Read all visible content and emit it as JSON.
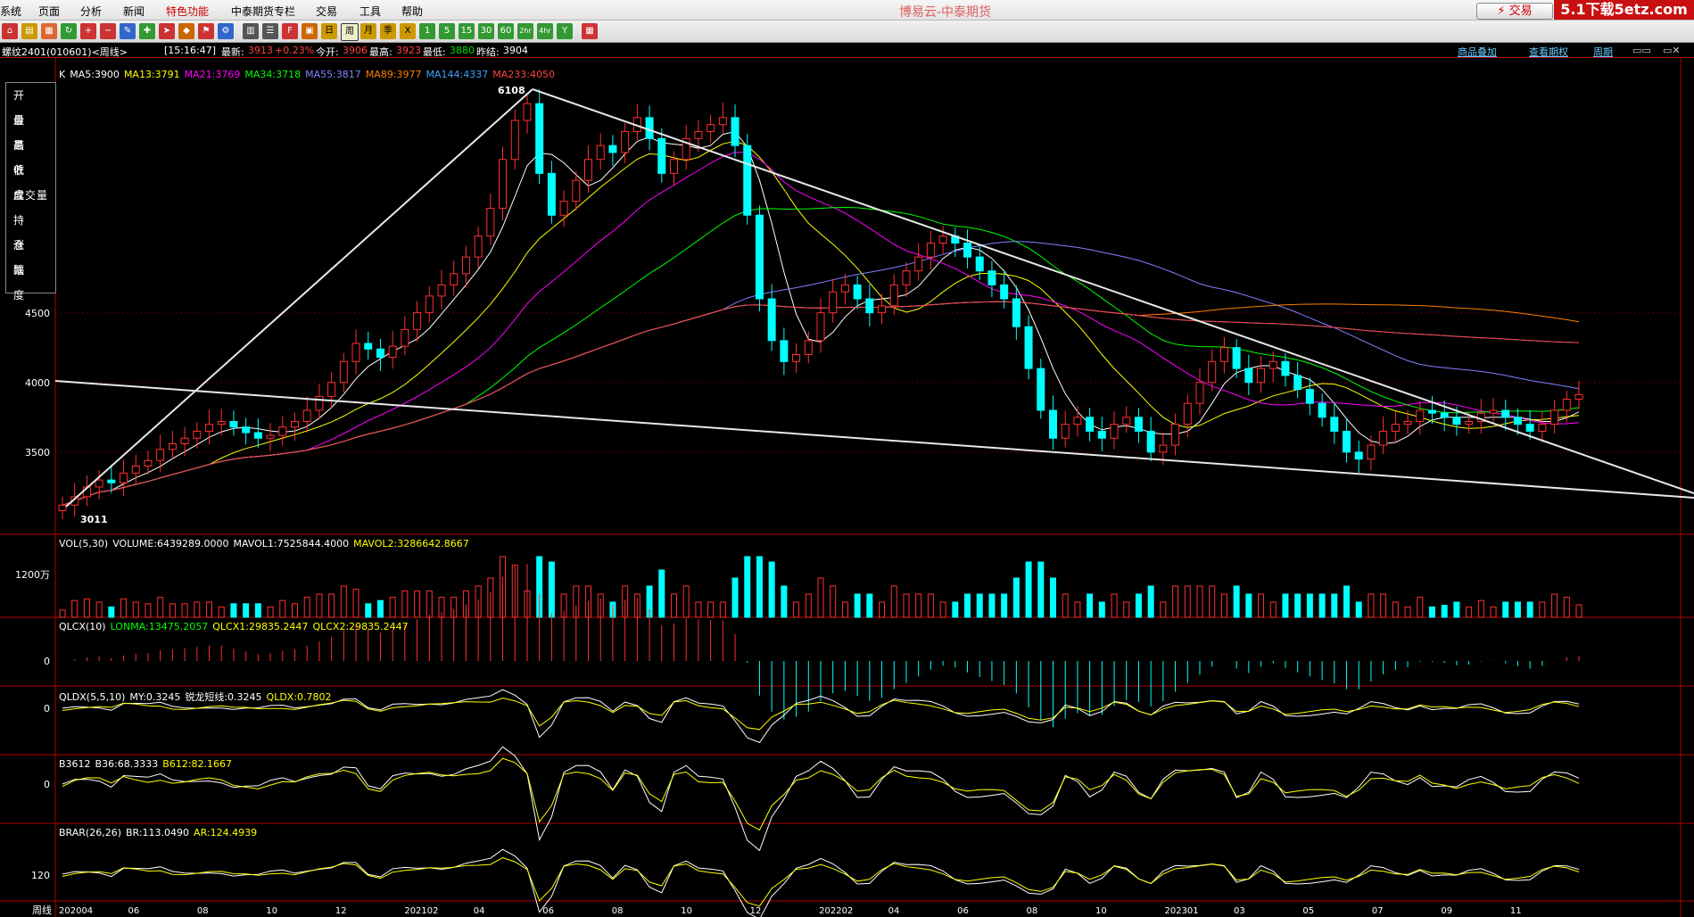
{
  "menu": [
    "系统",
    "页面",
    "分析",
    "新闻",
    "特色功能",
    "中泰期货专栏",
    "交易",
    "工具",
    "帮助"
  ],
  "app_title": "博易云-中泰期货",
  "trade_button": "交易",
  "watermark": "5.1下载5etz.com",
  "toolbar_buttons": [
    "home-icon",
    "folder-icon",
    "refresh-icon",
    "zoom-in-icon",
    "zoom-out-icon",
    "draw-icon",
    "crosshair-icon",
    "pin-icon",
    "table-icon",
    "text-icon",
    "ticket-icon",
    "calendar-icon",
    "week-icon",
    "month-icon",
    "quarter-icon",
    "x-icon",
    "1",
    "5",
    "15",
    "30",
    "60",
    "2hr",
    "4hr",
    "Y",
    "grid-icon"
  ],
  "toolbar_labels": {
    "calendar": "日",
    "week": "周",
    "month": "月",
    "quarter": "季",
    "x": "X",
    "1": "1",
    "5": "5",
    "15": "15",
    "30": "30",
    "60": "60",
    "2hr": "2hr",
    "4hr": "4hr",
    "Y": "Y"
  },
  "infobar": {
    "symbol": "螺纹2401(010601)<周线>",
    "time": "[15:16:47]",
    "latest_label": "最新:",
    "latest": "3913",
    "change": "+0.23%",
    "open_label": "今开:",
    "open": "3906",
    "high_label": "最高:",
    "high": "3923",
    "low_label": "最低:",
    "low": "3880",
    "prev_label": "昨结:",
    "prev": "3904",
    "links": [
      "商品叠加",
      "查看期权",
      "周期"
    ]
  },
  "left_panel": [
    "开 盘",
    "最 高",
    "最 低",
    "收 盘",
    "成交量",
    "持 仓",
    "涨 跌",
    "幅 度"
  ],
  "ma_header": [
    {
      "text": "K",
      "color": "#ffffff"
    },
    {
      "text": "MA5:3900",
      "color": "#ffffff"
    },
    {
      "text": "MA13:3791",
      "color": "#ffff00"
    },
    {
      "text": "MA21:3769",
      "color": "#ff00ff"
    },
    {
      "text": "MA34:3718",
      "color": "#00ff00"
    },
    {
      "text": "MA55:3817",
      "color": "#8080ff"
    },
    {
      "text": "MA89:3977",
      "color": "#ff8000"
    },
    {
      "text": "MA144:4337",
      "color": "#40a0ff"
    },
    {
      "text": "MA233:4050",
      "color": "#ff4040"
    }
  ],
  "price_axis": [
    "4500",
    "4000",
    "3500"
  ],
  "price_marks": {
    "high": "6108",
    "low": "3011"
  },
  "vol_header": [
    {
      "text": "VOL(5,30)",
      "color": "#ffffff"
    },
    {
      "text": "VOLUME:6439289.0000",
      "color": "#ffffff"
    },
    {
      "text": "MAVOL1:7525844.4000",
      "color": "#ffffff"
    },
    {
      "text": "MAVOL2:3286642.8667",
      "color": "#ffff00"
    }
  ],
  "vol_axis": "1200万",
  "qlcx_header": [
    {
      "text": "QLCX(10)",
      "color": "#ffffff"
    },
    {
      "text": "LONMA:13475.2057",
      "color": "#00ff00"
    },
    {
      "text": "QLCX1:29835.2447",
      "color": "#ffff00"
    },
    {
      "text": "QLCX2:29835.2447",
      "color": "#ffff00"
    }
  ],
  "qldx_header": [
    {
      "text": "QLDX(5,5,10)",
      "color": "#ffffff"
    },
    {
      "text": "MY:0.3245",
      "color": "#ffffff"
    },
    {
      "text": "锐龙短线:0.3245",
      "color": "#ffffff"
    },
    {
      "text": "QLDX:0.7802",
      "color": "#ffff00"
    }
  ],
  "b3612_header": [
    {
      "text": "B3612",
      "color": "#ffffff"
    },
    {
      "text": "B36:68.3333",
      "color": "#ffffff"
    },
    {
      "text": "B612:82.1667",
      "color": "#ffff00"
    }
  ],
  "brar_header": [
    {
      "text": "BRAR(26,26)",
      "color": "#ffffff"
    },
    {
      "text": "BR:113.0490",
      "color": "#ffffff"
    },
    {
      "text": "AR:124.4939",
      "color": "#ffff00"
    }
  ],
  "zero_label": "0",
  "brar_axis": "120",
  "period_label": "周线",
  "time_axis": [
    "202004",
    "06",
    "08",
    "10",
    "12",
    "202102",
    "04",
    "06",
    "08",
    "10",
    "12",
    "202202",
    "04",
    "06",
    "08",
    "10",
    "202301",
    "03",
    "05",
    "07",
    "09",
    "11"
  ],
  "colors": {
    "up": "#ff3030",
    "down": "#00ffff",
    "panel_border": "#b00000"
  },
  "chart_data": {
    "type": "candlestick",
    "period": "weekly",
    "ylim": [
      3000,
      6200
    ],
    "start": "2020-04",
    "x_ticks": [
      "202004",
      "06",
      "08",
      "10",
      "12",
      "202102",
      "04",
      "06",
      "08",
      "10",
      "12",
      "202202",
      "04",
      "06",
      "08",
      "10",
      "202301",
      "03",
      "05",
      "07",
      "09",
      "11"
    ],
    "close_series": [
      3120,
      3180,
      3250,
      3300,
      3280,
      3350,
      3400,
      3440,
      3520,
      3560,
      3600,
      3650,
      3700,
      3720,
      3680,
      3640,
      3600,
      3620,
      3680,
      3720,
      3800,
      3900,
      4000,
      4150,
      4280,
      4240,
      4180,
      4260,
      4380,
      4500,
      4620,
      4700,
      4780,
      4900,
      5050,
      5250,
      5600,
      5880,
      6000,
      5500,
      5200,
      5300,
      5450,
      5600,
      5700,
      5650,
      5800,
      5900,
      5750,
      5500,
      5600,
      5750,
      5800,
      5850,
      5900,
      5700,
      5200,
      4600,
      4300,
      4150,
      4200,
      4300,
      4500,
      4650,
      4700,
      4600,
      4500,
      4550,
      4700,
      4800,
      4900,
      5000,
      5050,
      5000,
      4900,
      4800,
      4700,
      4600,
      4400,
      4100,
      3800,
      3600,
      3700,
      3750,
      3650,
      3600,
      3700,
      3750,
      3650,
      3500,
      3550,
      3700,
      3850,
      4000,
      4150,
      4250,
      4100,
      4000,
      4100,
      4150,
      4050,
      3950,
      3850,
      3750,
      3650,
      3500,
      3450,
      3550,
      3650,
      3700,
      3720,
      3800,
      3780,
      3750,
      3700,
      3720,
      3780,
      3800,
      3750,
      3700,
      3650,
      3700,
      3800,
      3880,
      3913
    ],
    "annotations": {
      "max": "6108",
      "min": "3011"
    }
  }
}
